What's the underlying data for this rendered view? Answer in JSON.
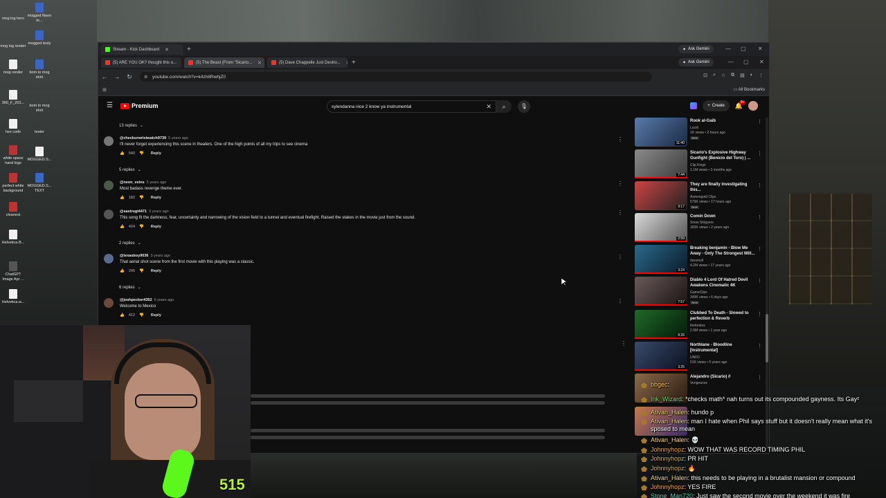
{
  "desktop": {
    "icons": [
      {
        "label": "mog log hero",
        "glyph": "file"
      },
      {
        "label": "mogged flavor te...",
        "glyph": "psd"
      },
      {
        "label": "mog log render",
        "glyph": "file"
      },
      {
        "label": "mogged texty",
        "glyph": "psd"
      },
      {
        "label": "mog render",
        "glyph": "psd"
      },
      {
        "label": "bom to mog shirt",
        "glyph": "psd"
      },
      {
        "label": "360_F_201...",
        "glyph": "file"
      },
      {
        "label": "bom to mog shirt",
        "glyph": "file"
      },
      {
        "label": "hex code",
        "glyph": "file"
      },
      {
        "label": "tester",
        "glyph": "file"
      },
      {
        "label": "white space hand logs",
        "glyph": "red"
      },
      {
        "label": "MOGGED.S...",
        "glyph": "file"
      },
      {
        "label": "perfect white background",
        "glyph": "red"
      },
      {
        "label": "MOGGED.S... TEXT",
        "glyph": "psd"
      },
      {
        "label": "cleanest",
        "glyph": "red"
      },
      {
        "label": "Helvetica-B...",
        "glyph": "file"
      },
      {
        "label": "ChatGPT Image Apr ...",
        "glyph": "file"
      },
      {
        "label": "Helvetica.w...",
        "glyph": "file"
      }
    ]
  },
  "browser": {
    "window1_tab": "Stream - Kick Dashboard",
    "tabs": [
      {
        "label": "(5) ARE YOU OK? thought this o..."
      },
      {
        "label": "(5) The Beast (From \"Sicario..."
      },
      {
        "label": "(5) Dave Chappelle Just Destro..."
      }
    ],
    "new_tab": "+",
    "gemini_label": "Ask Gemini",
    "url": "youtube.com/watch?v=k4zh8RwhjZ0",
    "all_bookmarks": "All Bookmarks"
  },
  "youtube": {
    "logo_text": "Premium",
    "search_value": "sylendanna nice 2 know ya instrumental",
    "create_label": "Create",
    "notif_count": "9+"
  },
  "comments": {
    "reply_groups": [
      {
        "label": "13 replies"
      },
      {
        "label": "5 replies"
      },
      {
        "label": "2 replies"
      },
      {
        "label": "6 replies"
      }
    ],
    "items": [
      {
        "author": "@checkurwristwatch9739",
        "time": "5 years ago",
        "text": "I'll never forget experiencing this scene in theaters. One of the high points of all my trips to see cinema",
        "likes": "540",
        "reply": "Reply"
      },
      {
        "author": "@neon_veins",
        "time": "5 years ago",
        "text": "Most badass revenge theme ever.",
        "likes": "182",
        "reply": "Reply"
      },
      {
        "author": "@sastrugi4471",
        "time": "3 years ago",
        "text": "This song fit the darkness, fear, uncertainty and narrowing of the vision field to a tunnel and eventual firefight. Raised the stakes in the movie just from the sound.",
        "likes": "424",
        "reply": "Reply"
      },
      {
        "author": "@texasboy9036",
        "time": "3 years ago",
        "text": "That aerial shot scene from the first movie with this playing was a classic.",
        "likes": "245",
        "reply": "Reply"
      },
      {
        "author": "@joshpecker4352",
        "time": "6 years ago",
        "text": "Welcome to Mexico",
        "likes": "412",
        "reply": "Reply"
      }
    ]
  },
  "recommended": [
    {
      "title": "Rook al-Gaib",
      "channel": "Lucid",
      "meta": "1K views • 2 hours ago",
      "badge": "New",
      "duration": "11:40"
    },
    {
      "title": "Sicario's Explosive Highway Gunfight (Benicio del Toro) | ...",
      "channel": "Clip Kings",
      "meta": "1.1M views • 3 months ago",
      "badge": "",
      "duration": "7:44"
    },
    {
      "title": "They are finally investigating this...",
      "channel": "Asmongold Clips",
      "meta": "579K views • 17 hours ago",
      "badge": "New",
      "duration": "9:17"
    },
    {
      "title": "Comin Down",
      "channel": "Snow Strippers",
      "meta": "183K views • 2 years ago",
      "badge": "",
      "duration": "2:59"
    },
    {
      "title": "Breaking benjamin - Blow Me Away - Only The Strongest Will...",
      "channel": "durumoll",
      "meta": "4.2M views • 17 years ago",
      "badge": "",
      "duration": "3:24"
    },
    {
      "title": "Diablo 4 Lord Of Hatred Devil Awakens Cinematic 4K",
      "channel": "GameClips",
      "meta": "349K views • 6 days ago",
      "badge": "New",
      "duration": "7:57"
    },
    {
      "title": "Clubbed To Death - Slowed to perfection & Reverb",
      "channel": "thefonkes",
      "meta": "2.9M views • 1 year ago",
      "badge": "",
      "duration": "8:26"
    },
    {
      "title": "Northlane - Bloodline [Instrumental]",
      "channel": "UNFD",
      "meta": "51K views • 5 years ago",
      "badge": "",
      "duration": "3:25"
    },
    {
      "title": "Alejandro (Sicario) //",
      "channel": "Vengeance",
      "meta": "",
      "badge": "",
      "duration": ""
    }
  ],
  "overlay": {
    "counter": "515",
    "chat": [
      {
        "user": "bbgec",
        "text": ":",
        "color": "#f3c76a"
      },
      {
        "user": "Ink_Wizard",
        "text": ": *checks math* nah turns out its compounded gayness. Its Gay²",
        "color": "#6fe063"
      },
      {
        "user": "Ativan_Halen",
        "text": ": hundo p",
        "color": "#f5d77a"
      },
      {
        "user": "Ativan_Halen",
        "text": ": man I hate when Phil says stuff but it doesn't really mean what it's sposed to mean",
        "color": "#f5d77a"
      },
      {
        "user": "Ativan_Halen",
        "text": ":",
        "color": "#f5d77a"
      },
      {
        "user": "Johnnyhopz",
        "text": ": WOW THAT WAS RECORD TIMING PHIL",
        "color": "#e7a73a"
      },
      {
        "user": "Johnnyhopz",
        "text": ": PR HIT",
        "color": "#e7a73a"
      },
      {
        "user": "Johnnyhopz",
        "text": ":",
        "color": "#e7a73a"
      },
      {
        "user": "Ativan_Halen",
        "text": ": this needs to be playing in a brutalist mansion or compound",
        "color": "#f5d77a"
      },
      {
        "user": "Johnnyhopz",
        "text": ": YES FIRE",
        "color": "#e7a73a"
      },
      {
        "user": "Stone_Man720",
        "text": ": Just saw the second movie over the weekend it was fire",
        "color": "#4fd0b0"
      }
    ]
  }
}
